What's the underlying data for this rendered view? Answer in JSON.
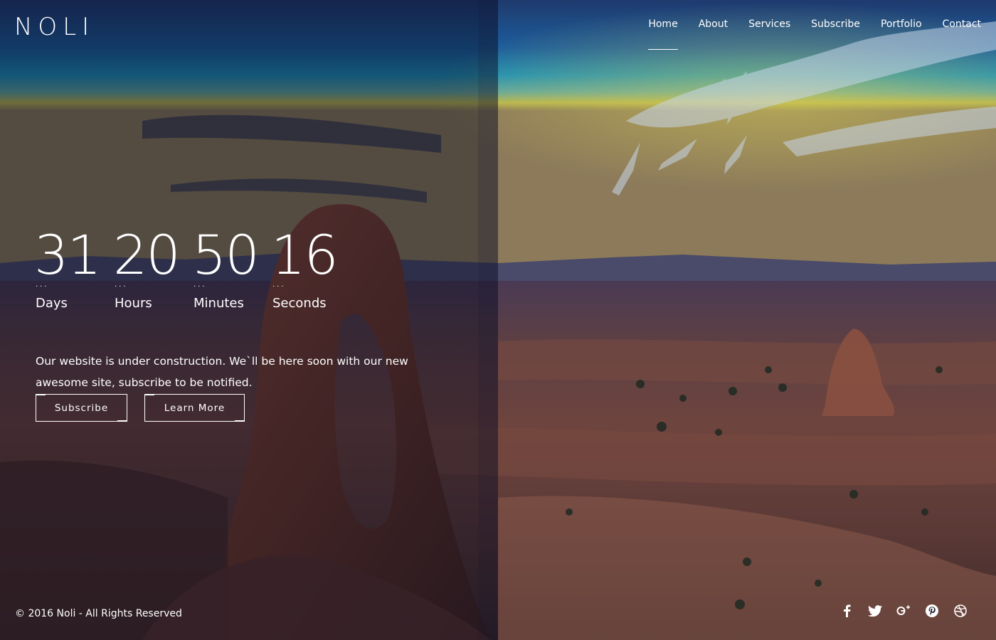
{
  "brand": {
    "logo_text": "NOLI"
  },
  "nav": {
    "items": [
      {
        "label": "Home",
        "active": true
      },
      {
        "label": "About",
        "active": false
      },
      {
        "label": "Services",
        "active": false
      },
      {
        "label": "Subscribe",
        "active": false
      },
      {
        "label": "Portfolio",
        "active": false
      },
      {
        "label": "Contact",
        "active": false
      }
    ]
  },
  "countdown": {
    "units": [
      {
        "value": "31",
        "label": "Days"
      },
      {
        "value": "20",
        "label": "Hours"
      },
      {
        "value": "50",
        "label": "Minutes"
      },
      {
        "value": "16",
        "label": "Seconds"
      }
    ]
  },
  "hero": {
    "description": "Our website is under construction. We`ll be here soon with our new awesome site, subscribe to be notified.",
    "subscribe_label": "Subscribe",
    "learn_more_label": "Learn More"
  },
  "footer": {
    "copyright": "© 2016 Noli - All Rights Reserved",
    "social": [
      "facebook-icon",
      "twitter-icon",
      "google-plus-icon",
      "pinterest-icon",
      "dribbble-icon"
    ]
  },
  "colors": {
    "text": "#ffffff",
    "overlay": "#080a1e"
  }
}
